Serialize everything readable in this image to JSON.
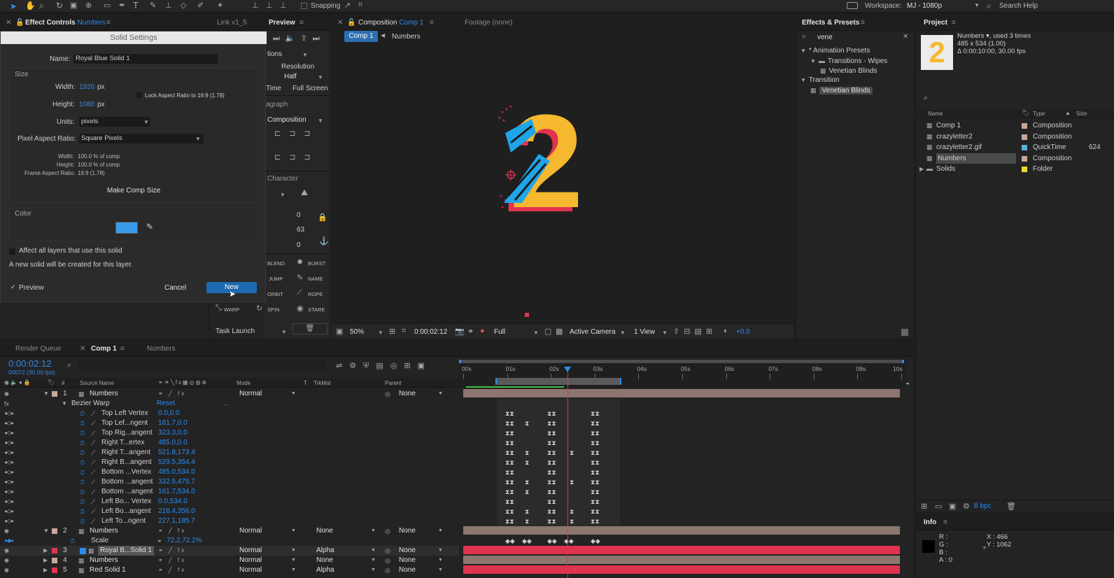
{
  "toolbar": {
    "snapping": "Snapping",
    "workspace_label": "Workspace:",
    "workspace_value": "MJ - 1080p",
    "search_help": "Search Help"
  },
  "effect_controls": {
    "tab_label": "Effect Controls",
    "layer_name": "Numbers",
    "link_tab": "Link v1_5"
  },
  "preview": {
    "tab_label": "Preview",
    "options": "tions",
    "resolution": "Resolution",
    "half": "Half",
    "time": "Time",
    "full_screen": "Full Screen",
    "paragraph": "agraph",
    "composition": "Composition",
    "character": "Character",
    "val_0a": "0",
    "val_63": "63",
    "val_0b": "0",
    "presets": [
      "BLEND",
      "BURST",
      "JUMP",
      "NAME",
      "ORBIT",
      "ROPE",
      "WARP",
      "SPIN",
      "STARE"
    ],
    "task_launch": "Task Launch"
  },
  "solid_settings": {
    "title": "Solid Settings",
    "name_label": "Name:",
    "name_value": "Royal Blue Solid 1",
    "size_label": "Size",
    "width_label": "Width:",
    "width_value": "1920",
    "height_label": "Height:",
    "height_value": "1080",
    "px": "px",
    "lock_aspect": "Lock Aspect Ratio to 16:9 (1.78)",
    "units_label": "Units:",
    "units_value": "pixels",
    "par_label": "Pixel Aspect Ratio:",
    "par_value": "Square Pixels",
    "info_width_label": "Width:",
    "info_width": "100.0 % of comp",
    "info_height_label": "Height:",
    "info_height": "100.0 % of comp",
    "far_label": "Frame Aspect Ratio:",
    "far_value": "16:9 (1.78)",
    "make_comp_size": "Make Comp Size",
    "color_label": "Color",
    "color_swatch": "#3a9bea",
    "affect_all": "Affect all layers that use this solid",
    "note": "A new solid will be created for this layer.",
    "preview": "Preview",
    "cancel": "Cancel",
    "new": "New"
  },
  "composition": {
    "tab_label": "Composition",
    "tab_comp": "Comp 1",
    "footage": "Footage (none)",
    "crumb_comp": "Comp 1",
    "crumb_numbers": "Numbers",
    "glyph": "2",
    "zoom": "50%",
    "timecode": "0:00:02:12",
    "quality": "Full",
    "camera": "Active Camera",
    "view": "1 View",
    "exposure": "+0.0"
  },
  "effects_presets": {
    "tab_label": "Effects & Presets",
    "search_value": "vene",
    "tree": [
      {
        "label": "* Animation Presets",
        "level": 0
      },
      {
        "label": "Transitions - Wipes",
        "level": 1
      },
      {
        "label": "Venetian Blinds",
        "level": 2
      },
      {
        "label": "Transition",
        "level": 0
      },
      {
        "label": "Venetian Blinds",
        "level": 1,
        "selected": true
      }
    ]
  },
  "project": {
    "tab_label": "Project",
    "item_name": "Numbers",
    "used": ", used 3 times",
    "dims": "485 x 534 (1.00)",
    "duration": "Δ 0:00:10:00, 30.00 fps",
    "thumb_glyph": "2",
    "col_name": "Name",
    "col_type": "Type",
    "col_size": "Size",
    "items": [
      {
        "name": "Comp 1",
        "type": "Composition",
        "size": "",
        "color": "#c7a79a"
      },
      {
        "name": "crazyletter2",
        "type": "Composition",
        "size": "",
        "color": "#c7a79a"
      },
      {
        "name": "crazyletter2.gif",
        "type": "QuickTime",
        "size": "624",
        "color": "#5ab2d8"
      },
      {
        "name": "Numbers",
        "type": "Composition",
        "size": "",
        "color": "#c7a79a",
        "selected": true
      },
      {
        "name": "Solids",
        "type": "Folder",
        "size": "",
        "color": "#e6d92a"
      }
    ],
    "bpc": "8 bpc"
  },
  "info": {
    "tab_label": "Info",
    "r": "R :",
    "g": "G :",
    "b": "B :",
    "a": "A : 0",
    "x": "X : 466",
    "y": "Y : 1062"
  },
  "timeline": {
    "tabs": [
      "Render Queue",
      "Comp 1",
      "Numbers"
    ],
    "timecode": "0:00:02:12",
    "frame": "00072 (30.00 fps)",
    "col_source": "Source Name",
    "col_mode": "Mode",
    "col_t": "T",
    "col_trkmat": "TrkMat",
    "col_parent": "Parent",
    "ruler": [
      "00s",
      "01s",
      "02s",
      "03s",
      "04s",
      "05s",
      "06s",
      "07s",
      "08s",
      "09s",
      "10s"
    ],
    "layer1": {
      "num": "1",
      "name": "Numbers",
      "mode": "Normal",
      "parent": "None",
      "color": "#c7a79a"
    },
    "effect": {
      "name": "Bezier Warp",
      "reset": "Reset",
      "dots": "..."
    },
    "props": [
      {
        "name": "Top Left Vertex",
        "value": "0.0,0.0"
      },
      {
        "name": "Top Lef...ngent",
        "value": "161.7,0.0"
      },
      {
        "name": "Top Rig...angent",
        "value": "323.3,0.0"
      },
      {
        "name": "Right T...ertex",
        "value": "485.0,0.0"
      },
      {
        "name": "Right T...angent",
        "value": "521.8,173.4"
      },
      {
        "name": "Right B...angent",
        "value": "529.5,354.4"
      },
      {
        "name": "Bottom ...Vertex",
        "value": "485.0,534.0"
      },
      {
        "name": "Bottom ...angent",
        "value": "332.5,475.7"
      },
      {
        "name": "Bottom ...angent",
        "value": "161.7,534.0"
      },
      {
        "name": "Left Bo... Vertex",
        "value": "0.0,534.0"
      },
      {
        "name": "Left Bo...angent",
        "value": "216.4,356.0"
      },
      {
        "name": "Left To...ngent",
        "value": "227.1,185.7"
      }
    ],
    "layer2": {
      "num": "2",
      "name": "Numbers",
      "mode": "Normal",
      "trkmat": "None",
      "parent": "None",
      "color": "#c7a79a"
    },
    "scale": {
      "name": "Scale",
      "value": "72.2,72.2%"
    },
    "layer3": {
      "num": "3",
      "name": "Royal B...Solid 1",
      "mode": "Normal",
      "trkmat": "Alpha",
      "parent": "None",
      "color": "#e0334f"
    },
    "layer4": {
      "num": "4",
      "name": "Numbers",
      "mode": "Normal",
      "trkmat": "None",
      "parent": "None",
      "color": "#c7a79a"
    },
    "layer5": {
      "num": "5",
      "name": "Red Solid 1",
      "mode": "Normal",
      "trkmat": "Alpha",
      "parent": "None",
      "color": "#e0334f"
    }
  }
}
